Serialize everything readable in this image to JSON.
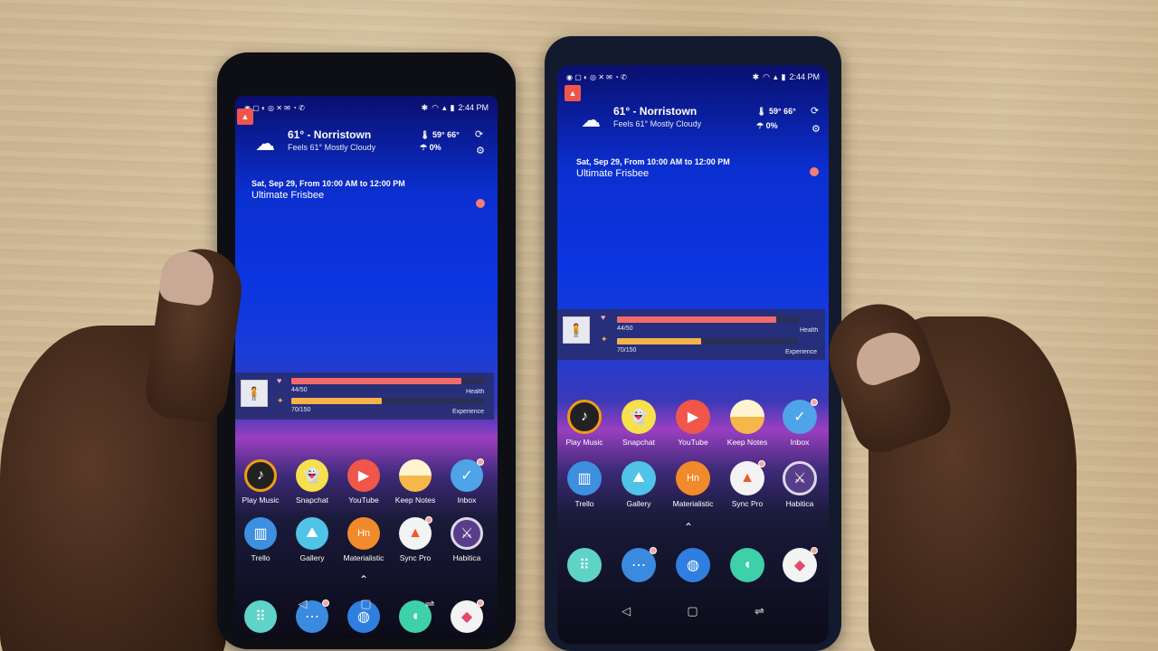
{
  "scene": {
    "description_colors": {
      "wood": "#d2bc98",
      "skin": "#3f2719",
      "left_phone_body": "#0d0f14",
      "right_phone_body": "#141a2e"
    }
  },
  "phones": [
    {
      "status": {
        "time": "2:44 PM"
      },
      "weather": {
        "city_temp": "61° - Norristown",
        "feels": "Feels 61° Mostly Cloudy",
        "hilo": "59° 66°",
        "precip": "0%"
      },
      "event": {
        "when": "Sat, Sep 29, From 10:00 AM to 12:00 PM",
        "title": "Ultimate Frisbee"
      },
      "habitica": {
        "health_text": "44/50",
        "health_label": "Health",
        "health_value": 44,
        "health_max": 50,
        "xp_text": "70/150",
        "xp_label": "Experience",
        "xp_value": 70,
        "xp_max": 150
      },
      "apps_row1": [
        "Play Music",
        "Snapchat",
        "YouTube",
        "Keep Notes",
        "Inbox"
      ],
      "apps_row2": [
        "Trello",
        "Gallery",
        "Materialistic",
        "Sync Pro",
        "Habitica"
      ]
    },
    {
      "status": {
        "time": "2:44 PM"
      },
      "weather": {
        "city_temp": "61° - Norristown",
        "feels": "Feels 61° Mostly Cloudy",
        "hilo": "59° 66°",
        "precip": "0%"
      },
      "event": {
        "when": "Sat, Sep 29, From 10:00 AM to 12:00 PM",
        "title": "Ultimate Frisbee"
      },
      "habitica": {
        "health_text": "44/50",
        "health_label": "Health",
        "health_value": 44,
        "health_max": 50,
        "xp_text": "70/150",
        "xp_label": "Experience",
        "xp_value": 70,
        "xp_max": 150
      },
      "apps_row1": [
        "Play Music",
        "Snapchat",
        "YouTube",
        "Keep Notes",
        "Inbox"
      ],
      "apps_row2": [
        "Trello",
        "Gallery",
        "Materialistic",
        "Sync Pro",
        "Habitica"
      ]
    }
  ],
  "app_icon_colors": {
    "Play Music": "#f39c12",
    "Snapchat": "#f6e04b",
    "YouTube": "#f0564a",
    "Keep Notes": "#f6b74a",
    "Inbox": "#4fa3e8",
    "Trello": "#3d8fe0",
    "Gallery": "#4fc3e8",
    "Materialistic": "#f08a2a",
    "Sync Pro": "#f3f3f3",
    "Habitica": "#5a3d8a"
  },
  "dock_icons": [
    "dialer-icon",
    "messages-icon",
    "browser-icon",
    "chat-icon",
    "photos-icon"
  ],
  "nav_icons": [
    "back-icon",
    "home-icon",
    "recents-icon"
  ]
}
